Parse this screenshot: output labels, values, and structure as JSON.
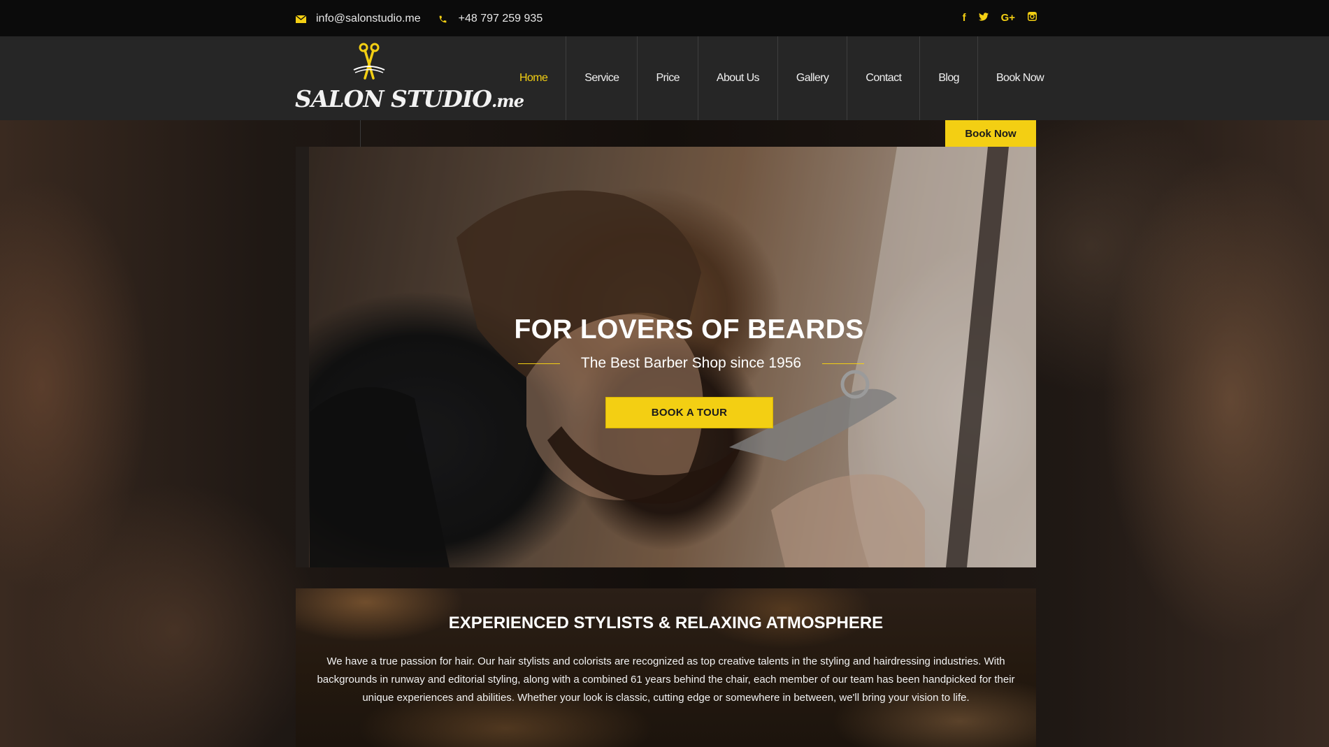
{
  "topbar": {
    "email": "info@salonstudio.me",
    "phone": "+48 797 259 935",
    "icons": {
      "email": "envelope-icon",
      "phone": "phone-icon"
    },
    "social": [
      {
        "name": "facebook-icon",
        "glyph": "f"
      },
      {
        "name": "twitter-icon",
        "glyph": "t"
      },
      {
        "name": "google-plus-icon",
        "glyph": "G+"
      },
      {
        "name": "instagram-icon",
        "glyph": "◘"
      }
    ]
  },
  "logo": {
    "text": "SALON STUDIO.me",
    "icon": "scissors-icon"
  },
  "nav": {
    "items": [
      "Home",
      "Service",
      "Price",
      "About Us",
      "Gallery",
      "Contact",
      "Blog",
      "Book Now"
    ],
    "active": "Home"
  },
  "book_now_button": "Book Now",
  "hero": {
    "title": "FOR LOVERS OF BEARDS",
    "subtitle": "The Best Barber Shop since 1956",
    "button": "BOOK A TOUR"
  },
  "info": {
    "title": "EXPERIENCED STYLISTS & RELAXING ATMOSPHERE",
    "text": "We have a true passion for hair. Our hair stylists and colorists are recognized as top creative talents in the styling and hairdressing industries. With backgrounds in runway and editorial styling, along with a combined 61 years behind the chair, each member of our team has been handpicked for their unique experiences and abilities. Whether your look is classic, cutting edge or somewhere in between, we'll bring your vision to life."
  },
  "colors": {
    "accent": "#f3cf13",
    "topbar": "#0b0b0b",
    "header": "#262626"
  }
}
